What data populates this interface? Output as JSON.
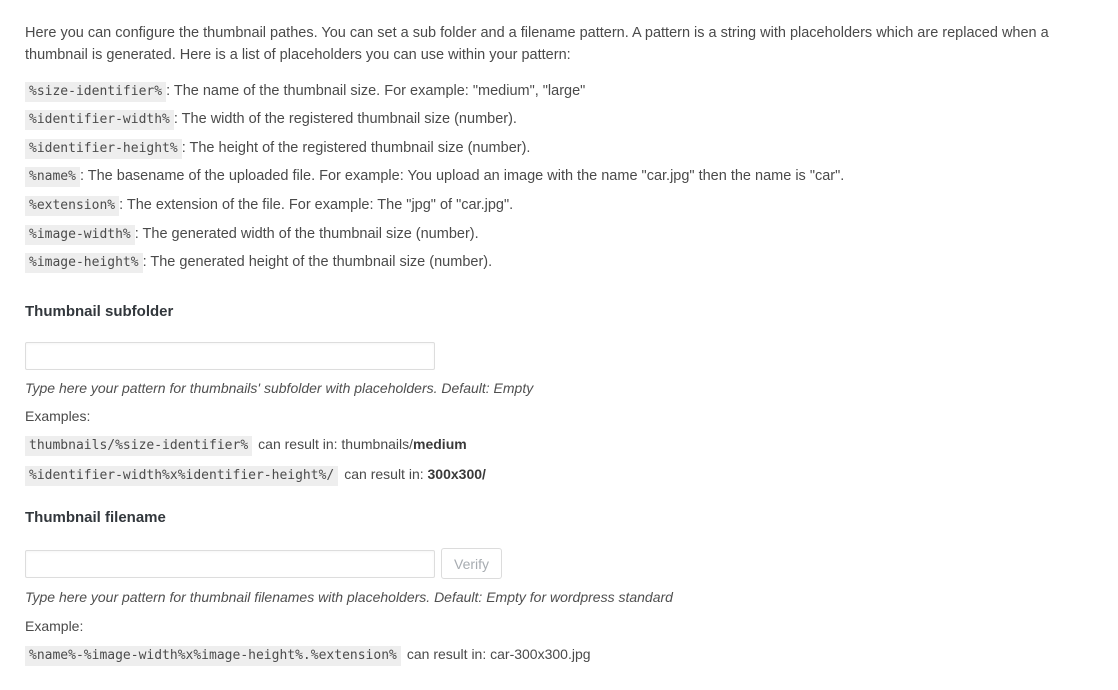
{
  "intro": "Here you can configure the thumbnail pathes. You can set a sub folder and a filename pattern. A pattern is a string with placeholders which are replaced when a thumbnail is generated. Here is a list of placeholders you can use within your pattern:",
  "placeholders": [
    {
      "token": "%size-identifier%",
      "description": ": The name of the thumbnail size. For example: \"medium\", \"large\""
    },
    {
      "token": "%identifier-width%",
      "description": ": The width of the registered thumbnail size (number)."
    },
    {
      "token": "%identifier-height%",
      "description": ": The height of the registered thumbnail size (number)."
    },
    {
      "token": "%name%",
      "description": ": The basename of the uploaded file. For example: You upload an image with the name \"car.jpg\" then the name is \"car\"."
    },
    {
      "token": "%extension%",
      "description": ": The extension of the file. For example: The \"jpg\" of \"car.jpg\"."
    },
    {
      "token": "%image-width%",
      "description": ": The generated width of the thumbnail size (number)."
    },
    {
      "token": "%image-height%",
      "description": ": The generated height of the thumbnail size (number)."
    }
  ],
  "subfolder": {
    "title": "Thumbnail subfolder",
    "input_value": "",
    "input_placeholder": "",
    "hint": "Type here your pattern for thumbnails' subfolder with placeholders. Default: Empty",
    "examples_label": "Examples:",
    "examples": [
      {
        "pattern": "thumbnails/%size-identifier%",
        "result_prefix": "can result in: thumbnails/",
        "result_bold": "medium"
      },
      {
        "pattern": "%identifier-width%x%identifier-height%/",
        "result_prefix": "can result in: ",
        "result_bold": "300x300/"
      }
    ]
  },
  "filename": {
    "title": "Thumbnail filename",
    "input_value": "",
    "input_placeholder": "",
    "verify_label": "Verify",
    "hint": "Type here your pattern for thumbnail filenames with placeholders. Default: Empty for wordpress standard",
    "examples_label": "Example:",
    "examples": [
      {
        "pattern": "%name%-%image-width%x%image-height%.%extension%",
        "result_prefix": "can result in: car-300x300.jpg",
        "result_bold": ""
      }
    ]
  },
  "colors": {
    "code_background": "#eeeeee",
    "text": "#4a4a4a",
    "heading": "#32373c",
    "input_border": "#dddddd",
    "button_disabled_text": "#a7acb1"
  }
}
